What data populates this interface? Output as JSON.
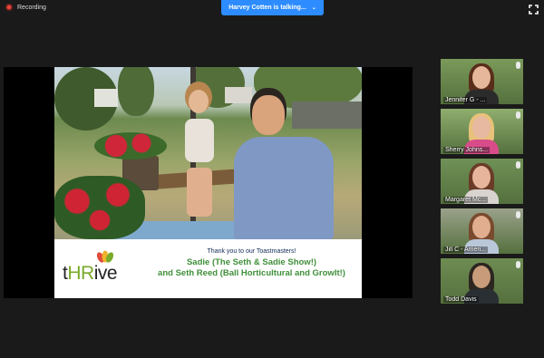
{
  "recording": {
    "label": "Recording"
  },
  "speaker_banner": {
    "label": "Harvey Cotten is talking..."
  },
  "main_video": {
    "banner": {
      "logo_t": "t",
      "logo_hr": "HR",
      "logo_ive": "ive",
      "line1": "Thank you to our Toastmasters!",
      "line2": "Sadie (The Seth & Sadie Show!)",
      "line3": "and Seth Reed (Ball Horticultural and GrowIt!)"
    }
  },
  "participants": [
    {
      "name": "Jennifer G - ...",
      "bg": "#7a9a5a",
      "skin": "#e6b79a",
      "hair": "#5a2d1a",
      "shirt": "#2b2b2b"
    },
    {
      "name": "Sherry Johns...",
      "bg": "#8fae6e",
      "skin": "#e6b9a0",
      "hair": "#e8c27a",
      "shirt": "#d94c8a"
    },
    {
      "name": "Margaret Mc...",
      "bg": "#6f9156",
      "skin": "#e7b59c",
      "hair": "#6a3b26",
      "shirt": "#d8d3cf"
    },
    {
      "name": "Jill C - Ameri...",
      "bg": "#9aa28a",
      "skin": "#e1ae90",
      "hair": "#7a4a2e",
      "shirt": "#b9c7d8"
    },
    {
      "name": "Todd Davis",
      "bg": "#6e8c52",
      "skin": "#c89c7a",
      "hair": "#2c2520",
      "shirt": "#2a2f33"
    }
  ]
}
